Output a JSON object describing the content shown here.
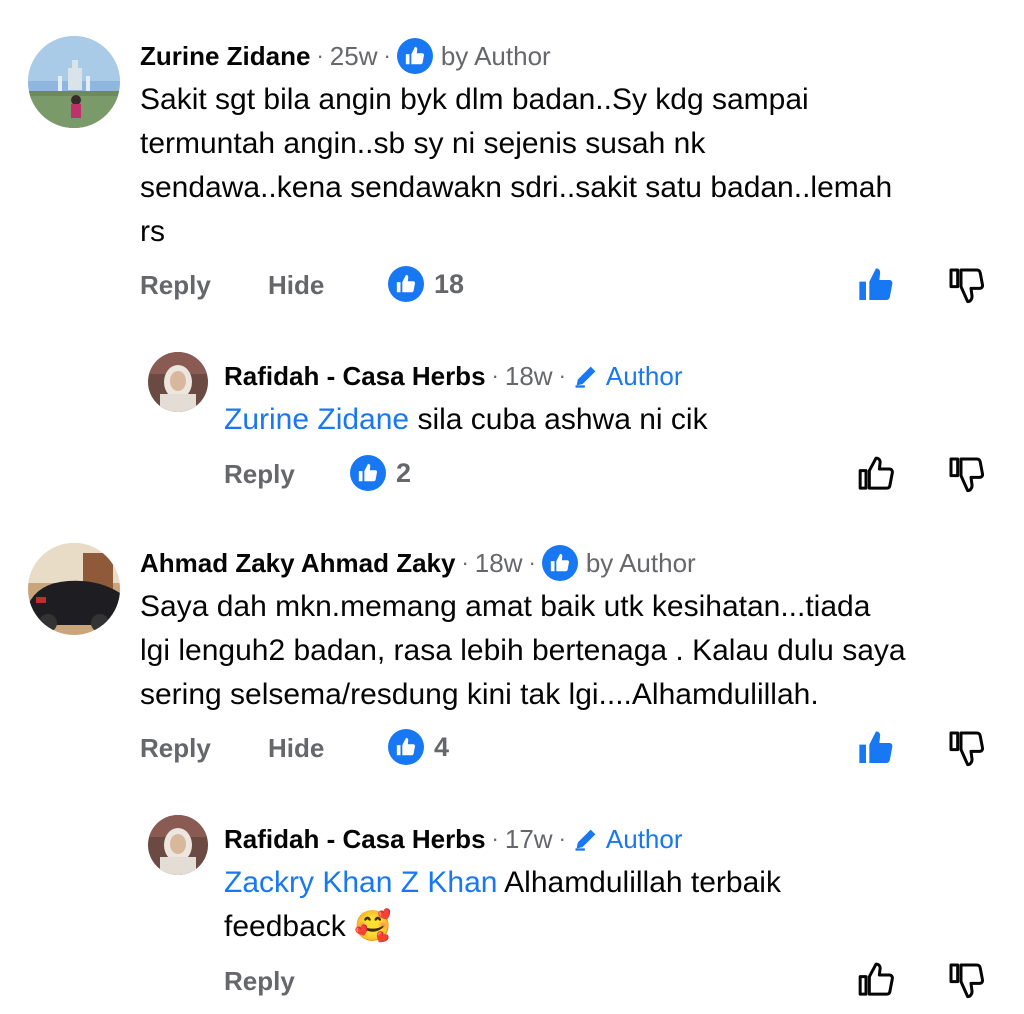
{
  "comments": [
    {
      "name": "Zurine Zidane",
      "time": "25w",
      "badge": "by Author",
      "text_lines": [
        "Sakit sgt bila angin byk dlm badan..Sy kdg sampai",
        "termuntah angin..sb sy ni sejenis susah nk",
        "sendawa..kena sendawakn sdri..sakit satu badan..lemah",
        "rs"
      ],
      "reply_label": "Reply",
      "hide_label": "Hide",
      "like_count": "18",
      "upvoted": true
    },
    {
      "name": "Rafidah - Casa Herbs",
      "time": "18w",
      "badge": "Author",
      "mention": "Zurine Zidane",
      "text": " sila cuba ashwa ni cik",
      "reply_label": "Reply",
      "like_count": "2",
      "upvoted": false
    },
    {
      "name": "Ahmad Zaky Ahmad Zaky",
      "time": "18w",
      "badge": "by Author",
      "text_lines": [
        "Saya dah mkn.memang amat baik utk kesihatan...tiada",
        "lgi lenguh2 badan, rasa lebih bertenaga . Kalau dulu saya",
        "sering selsema/resdung kini tak lgi....Alhamdulillah."
      ],
      "reply_label": "Reply",
      "hide_label": "Hide",
      "like_count": "4",
      "upvoted": true
    },
    {
      "name": "Rafidah - Casa Herbs",
      "time": "17w",
      "badge": "Author",
      "mention": "Zackry Khan Z Khan",
      "text_line1": " Alhamdulillah terbaik",
      "text_line2": "feedback",
      "emoji": "🥰",
      "reply_label": "Reply",
      "upvoted": false
    }
  ],
  "separator": "·",
  "icons": {
    "author_badge": "thumbs-up-badge-icon",
    "author_edit": "pencil-icon",
    "upvote": "thumbs-up-icon",
    "downvote": "thumbs-down-icon"
  },
  "colors": {
    "accent": "#1877f2",
    "secondary_text": "#65676b",
    "primary_text": "#050505"
  }
}
